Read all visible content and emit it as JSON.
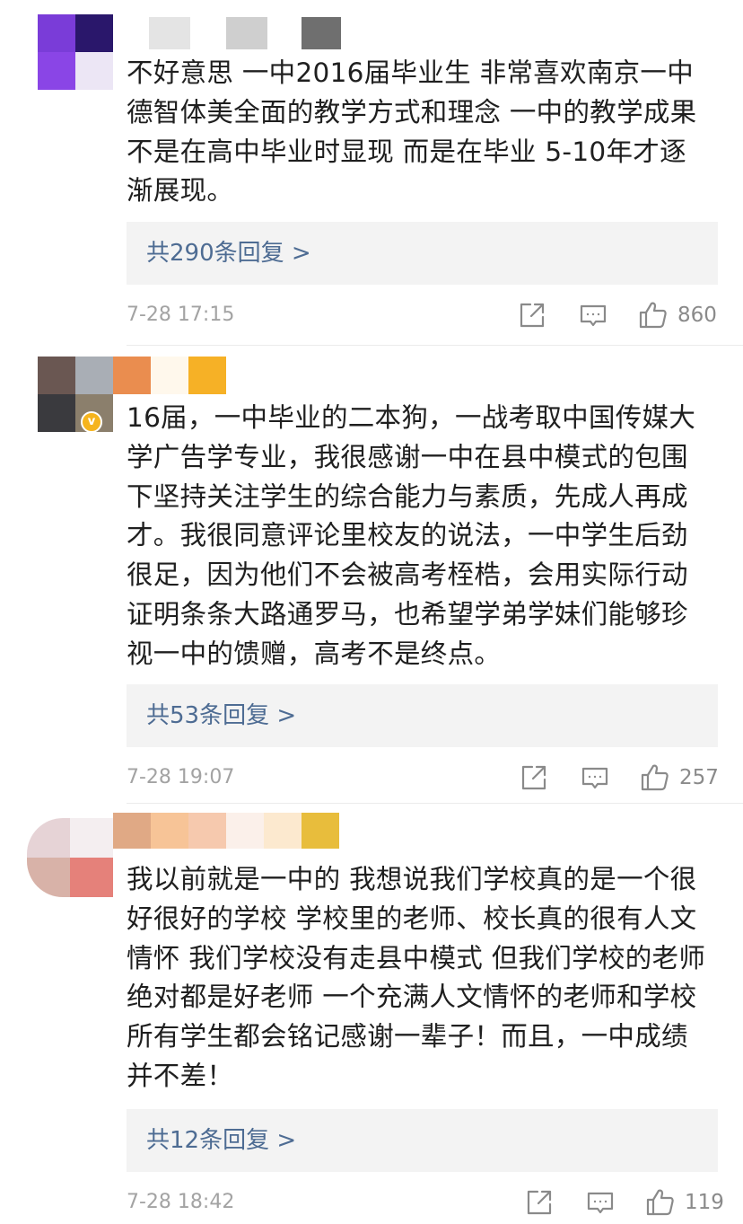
{
  "comments": [
    {
      "text_lines": [
        "不好意思 一中2016届毕业生 非常喜欢南京一中",
        "德智体美全面的教学方式和理念 一中的教学成果",
        "不是在高中毕业时显现 而是在毕业 5-10年才逐",
        "渐展现。"
      ],
      "replies_label": "共290条回复 >",
      "time": "7-28 17:15",
      "likes": "860"
    },
    {
      "text_lines": [
        "16届，一中毕业的二本狗，一战考取中国传媒大",
        "学广告学专业，我很感谢一中在县中模式的包围",
        "下坚持关注学生的综合能力与素质，先成人再成",
        "才。我很同意评论里校友的说法，一中学生后劲",
        "很足，因为他们不会被高考桎梏，会用实际行动",
        "证明条条大路通罗马，也希望学弟学妹们能够珍",
        "视一中的馈赠，高考不是终点。"
      ],
      "replies_label": "共53条回复 >",
      "time": "7-28 19:07",
      "likes": "257",
      "verified_badge": "v"
    },
    {
      "text_lines": [
        "我以前就是一中的 我想说我们学校真的是一个很",
        "好很好的学校 学校里的老师、校长真的很有人文",
        "情怀 我们学校没有走县中模式 但我们学校的老师",
        "绝对都是好老师 一个充满人文情怀的老师和学校",
        "所有学生都会铭记感谢一辈子！而且，一中成绩",
        "并不差！"
      ],
      "replies_label": "共12条回复 >",
      "time": "7-28 18:42",
      "likes": "119"
    }
  ],
  "icons": {
    "share": "share-icon",
    "comment": "comment-icon",
    "like": "thumbs-up-icon"
  },
  "colors": {
    "reply_link": "#4e6c93",
    "reply_bg": "#f3f3f3",
    "meta_gray": "#a3a3a3",
    "icon_gray": "#8a8a8a",
    "verified": "#f5b41e"
  }
}
